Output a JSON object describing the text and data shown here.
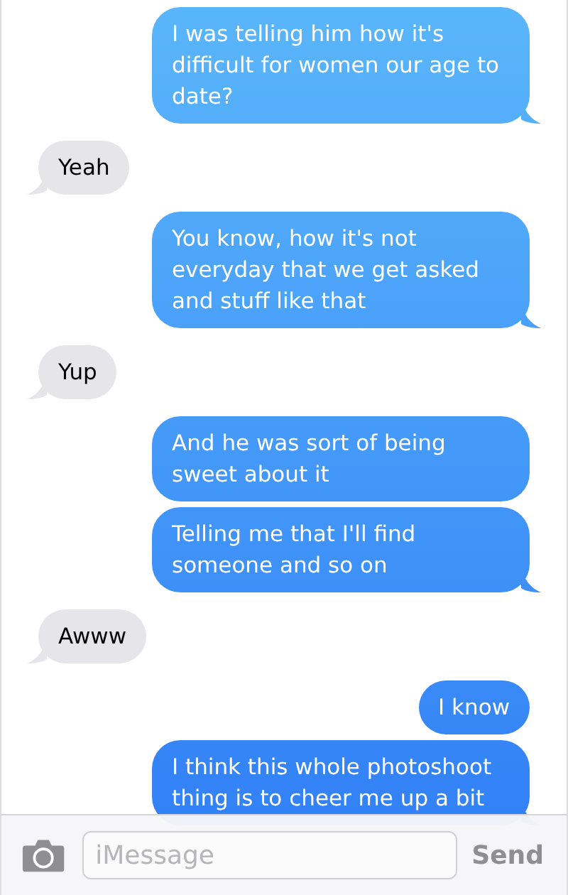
{
  "messages": [
    {
      "kind": "sent",
      "text": "I was telling him how it's difficult for women our age to date?",
      "tail": true
    },
    {
      "kind": "received",
      "text": "Yeah",
      "tail": true
    },
    {
      "kind": "sent",
      "text": "You know, how it's not everyday that we get asked and stuff like that",
      "tail": true
    },
    {
      "kind": "received",
      "text": "Yup",
      "tail": true
    },
    {
      "kind": "sent",
      "text": "And he was sort of being sweet about it",
      "tail": false
    },
    {
      "kind": "sent",
      "text": "Telling me that I'll find someone and so on",
      "tail": true
    },
    {
      "kind": "received",
      "text": "Awww",
      "tail": true
    },
    {
      "kind": "sent",
      "text": "I know",
      "tail": false
    },
    {
      "kind": "sent",
      "text": "I think this whole photoshoot thing is to cheer me up a bit",
      "tail": true
    }
  ],
  "composer": {
    "placeholder": "iMessage",
    "send_label": "Send"
  }
}
